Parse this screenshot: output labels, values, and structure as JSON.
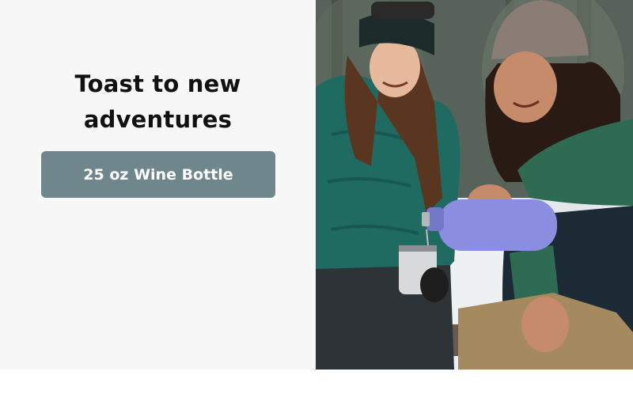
{
  "banner": {
    "headline": "Toast to new adventures",
    "cta_label": "25 oz Wine Bottle",
    "photo_icon": "lifestyle-photo",
    "colors": {
      "cta_background": "#6e868c",
      "panel_background": "#f7f7f7",
      "headline_text": "#111111"
    }
  }
}
